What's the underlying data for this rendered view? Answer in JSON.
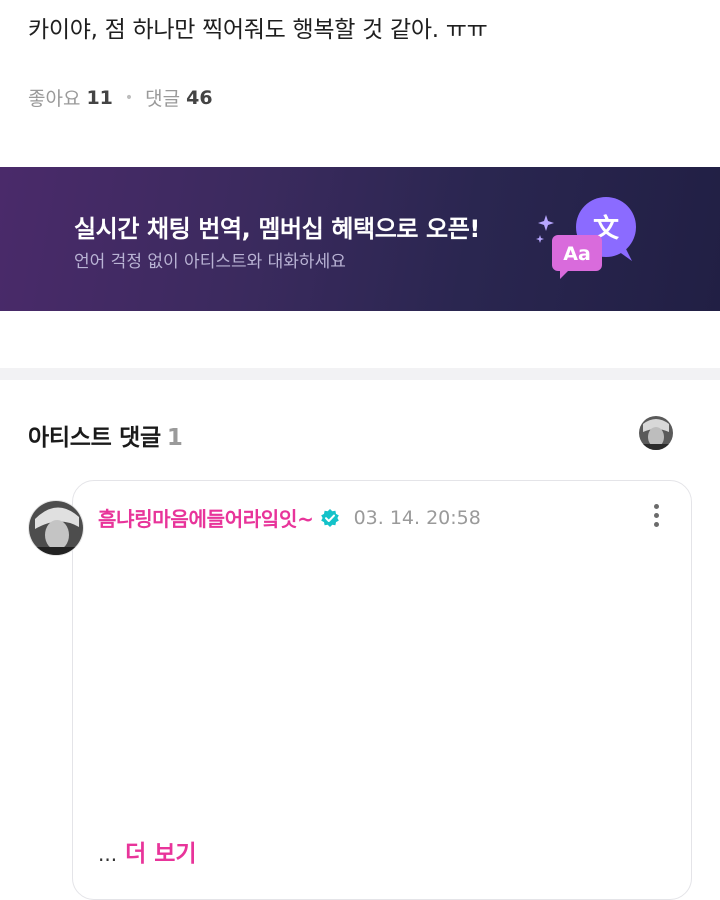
{
  "post": {
    "text": "카이야, 점 하나만 찍어줘도 행복할 것 같아. ㅠㅠ",
    "likes_label": "좋아요",
    "likes_count": "11",
    "comments_label": "댓글",
    "comments_count": "46"
  },
  "banner": {
    "title": "실시간 채팅 번역, 멤버십 혜택으로 오픈!",
    "subtitle": "언어 걱정 없이 아티스트와 대화하세요",
    "icon_text_a": "Aa",
    "icon_text_b": "文"
  },
  "artist_comments": {
    "title": "아티스트 댓글",
    "count": "1"
  },
  "comment": {
    "author": "흠냐링마음에들어라잌잇~",
    "timestamp": "03. 14. 20:58",
    "ellipsis": "...",
    "see_more": "더 보기"
  },
  "colors": {
    "accent_pink": "#e8349a",
    "verified_teal": "#14c2c9",
    "banner_start": "#4a2a6a",
    "banner_end": "#211f44"
  },
  "icons": {
    "verified": "verified-badge-icon",
    "more": "more-vertical-icon",
    "translate": "translate-bubble-icon",
    "sparkle": "sparkle-icon"
  }
}
